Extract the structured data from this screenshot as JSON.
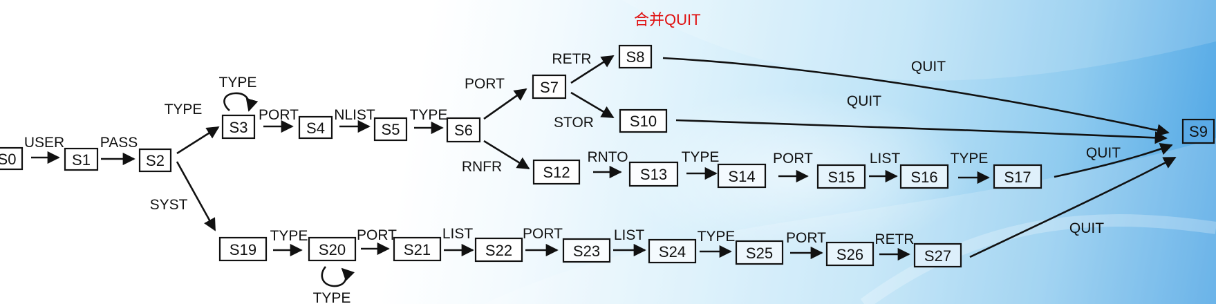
{
  "note": "合并QUIT",
  "states": [
    "S0",
    "S1",
    "S2",
    "S3",
    "S4",
    "S5",
    "S6",
    "S7",
    "S8",
    "S9",
    "S10",
    "S12",
    "S13",
    "S14",
    "S15",
    "S16",
    "S17",
    "S19",
    "S20",
    "S21",
    "S22",
    "S23",
    "S24",
    "S25",
    "S26",
    "S27"
  ],
  "edge_labels": {
    "s0_s1": "USER",
    "s1_s2": "PASS",
    "s2_s3": "TYPE",
    "s3_loop": "TYPE",
    "s3_s4": "PORT",
    "s4_s5": "NLIST",
    "s5_s6": "TYPE",
    "s6_s7": "PORT",
    "s7_s8": "RETR",
    "s7_s10": "STOR",
    "s6_s12": "RNFR",
    "s12_s13": "RNTO",
    "s13_s14": "TYPE",
    "s14_s15": "PORT",
    "s15_s16": "LIST",
    "s16_s17": "TYPE",
    "s2_s19": "SYST",
    "s19_s20": "TYPE",
    "s20_loop": "TYPE",
    "s20_s21": "PORT",
    "s21_s22": "LIST",
    "s22_s23": "PORT",
    "s23_s24": "LIST",
    "s24_s25": "TYPE",
    "s25_s26": "PORT",
    "s26_s27": "RETR",
    "s8_s9": "QUIT",
    "s10_s9": "QUIT",
    "s17_s9": "QUIT",
    "s27_s9": "QUIT"
  },
  "colors": {
    "note": "#e01010",
    "line": "#111111",
    "box_fill": "#ffffff",
    "box_fill_right": "#cfe8f8"
  }
}
